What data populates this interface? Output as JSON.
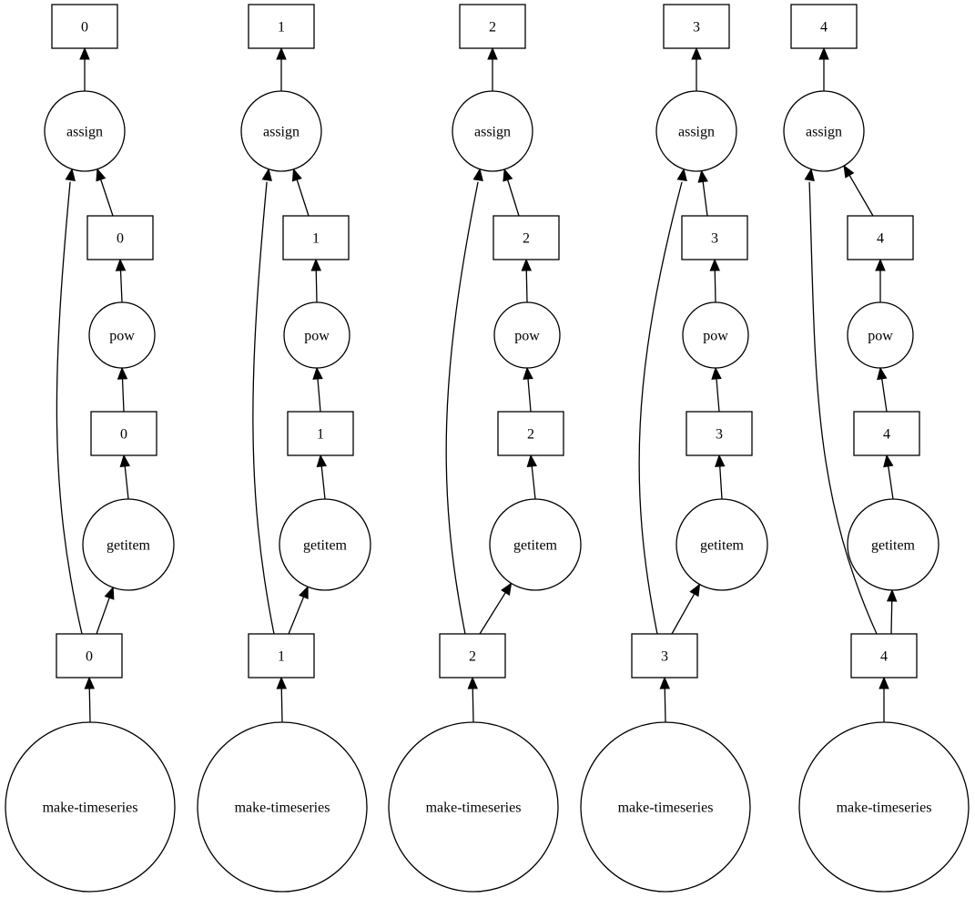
{
  "diagram": {
    "type": "task-graph",
    "direction": "bottom-to-top",
    "columns": [
      {
        "index": 0,
        "nodes": [
          {
            "id": "mts",
            "kind": "function",
            "label": "make-timeseries"
          },
          {
            "id": "part",
            "kind": "data",
            "label": "0"
          },
          {
            "id": "getitem",
            "kind": "function",
            "label": "getitem"
          },
          {
            "id": "gi_out",
            "kind": "data",
            "label": "0"
          },
          {
            "id": "pow",
            "kind": "function",
            "label": "pow"
          },
          {
            "id": "pow_out",
            "kind": "data",
            "label": "0"
          },
          {
            "id": "assign",
            "kind": "function",
            "label": "assign"
          },
          {
            "id": "result",
            "kind": "data",
            "label": "0"
          }
        ]
      },
      {
        "index": 1,
        "nodes": [
          {
            "id": "mts",
            "kind": "function",
            "label": "make-timeseries"
          },
          {
            "id": "part",
            "kind": "data",
            "label": "1"
          },
          {
            "id": "getitem",
            "kind": "function",
            "label": "getitem"
          },
          {
            "id": "gi_out",
            "kind": "data",
            "label": "1"
          },
          {
            "id": "pow",
            "kind": "function",
            "label": "pow"
          },
          {
            "id": "pow_out",
            "kind": "data",
            "label": "1"
          },
          {
            "id": "assign",
            "kind": "function",
            "label": "assign"
          },
          {
            "id": "result",
            "kind": "data",
            "label": "1"
          }
        ]
      },
      {
        "index": 2,
        "nodes": [
          {
            "id": "mts",
            "kind": "function",
            "label": "make-timeseries"
          },
          {
            "id": "part",
            "kind": "data",
            "label": "2"
          },
          {
            "id": "getitem",
            "kind": "function",
            "label": "getitem"
          },
          {
            "id": "gi_out",
            "kind": "data",
            "label": "2"
          },
          {
            "id": "pow",
            "kind": "function",
            "label": "pow"
          },
          {
            "id": "pow_out",
            "kind": "data",
            "label": "2"
          },
          {
            "id": "assign",
            "kind": "function",
            "label": "assign"
          },
          {
            "id": "result",
            "kind": "data",
            "label": "2"
          }
        ]
      },
      {
        "index": 3,
        "nodes": [
          {
            "id": "mts",
            "kind": "function",
            "label": "make-timeseries"
          },
          {
            "id": "part",
            "kind": "data",
            "label": "3"
          },
          {
            "id": "getitem",
            "kind": "function",
            "label": "getitem"
          },
          {
            "id": "gi_out",
            "kind": "data",
            "label": "3"
          },
          {
            "id": "pow",
            "kind": "function",
            "label": "pow"
          },
          {
            "id": "pow_out",
            "kind": "data",
            "label": "3"
          },
          {
            "id": "assign",
            "kind": "function",
            "label": "assign"
          },
          {
            "id": "result",
            "kind": "data",
            "label": "3"
          }
        ]
      },
      {
        "index": 4,
        "nodes": [
          {
            "id": "mts",
            "kind": "function",
            "label": "make-timeseries"
          },
          {
            "id": "part",
            "kind": "data",
            "label": "4"
          },
          {
            "id": "getitem",
            "kind": "function",
            "label": "getitem"
          },
          {
            "id": "gi_out",
            "kind": "data",
            "label": "4"
          },
          {
            "id": "pow",
            "kind": "function",
            "label": "pow"
          },
          {
            "id": "pow_out",
            "kind": "data",
            "label": "4"
          },
          {
            "id": "assign",
            "kind": "function",
            "label": "assign"
          },
          {
            "id": "result",
            "kind": "data",
            "label": "4"
          }
        ]
      }
    ],
    "edges": [
      {
        "from": "mts",
        "to": "part"
      },
      {
        "from": "part",
        "to": "getitem"
      },
      {
        "from": "getitem",
        "to": "gi_out"
      },
      {
        "from": "gi_out",
        "to": "pow"
      },
      {
        "from": "pow",
        "to": "pow_out"
      },
      {
        "from": "pow_out",
        "to": "assign"
      },
      {
        "from": "part",
        "to": "assign"
      },
      {
        "from": "assign",
        "to": "result"
      }
    ],
    "colors": {
      "stroke": "#000000",
      "fill": "#ffffff",
      "text": "#000000"
    }
  }
}
